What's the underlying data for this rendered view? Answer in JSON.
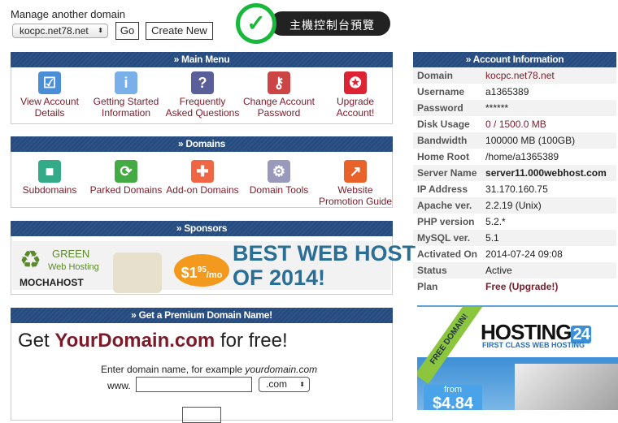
{
  "manage": {
    "label": "Manage another domain",
    "domain": "kocpc.net78.net",
    "go": "Go",
    "create": "Create New"
  },
  "badge": {
    "text": "主機控制台預覽",
    "color": "#18b83b"
  },
  "main_menu": {
    "title": "» Main Menu",
    "items": [
      {
        "l1": "View Account",
        "l2": "Details",
        "icon": "checklist-icon"
      },
      {
        "l1": "Getting Started",
        "l2": "Information",
        "icon": "info-icon"
      },
      {
        "l1": "Frequently",
        "l2": "Asked Questions",
        "icon": "question-icon"
      },
      {
        "l1": "Change Account",
        "l2": "Password",
        "icon": "keys-icon"
      },
      {
        "l1": "Upgrade",
        "l2": "Account!",
        "icon": "ribbon-icon"
      }
    ]
  },
  "domains": {
    "title": "» Domains",
    "items": [
      {
        "l1": "",
        "l2": "Subdomains",
        "icon": "cubes-icon"
      },
      {
        "l1": "",
        "l2": "Parked Domains",
        "icon": "arrows-icon"
      },
      {
        "l1": "",
        "l2": "Add-on Domains",
        "icon": "molecule-icon"
      },
      {
        "l1": "",
        "l2": "Domain Tools",
        "icon": "gears-icon"
      },
      {
        "l1": "Website",
        "l2": "Promotion Guide",
        "icon": "arrow-circle-icon"
      }
    ]
  },
  "sponsors": {
    "title": "» Sponsors",
    "ad": {
      "green": "GREEN",
      "web_hosting": "Web Hosting",
      "brand": "MOCHAHOST",
      "price": "$1",
      "cents": "95",
      "per": "/mo",
      "line1": "BEST WEB HOST",
      "line2": "OF 2014!"
    }
  },
  "premium": {
    "title": "» Get a Premium Domain Name!",
    "get": "Get ",
    "domain": "YourDomain.com",
    "free": " for free!",
    "hint": "Enter domain name, for example ",
    "hint_example": "yourdomain.com",
    "www": "www.",
    "tld": ".com",
    "input_value": ""
  },
  "account": {
    "title": "» Account Information",
    "rows": [
      {
        "k": "Domain",
        "v": "kocpc.net78.net"
      },
      {
        "k": "Username",
        "v": "a1365389"
      },
      {
        "k": "Password",
        "v": "******"
      },
      {
        "k": "Disk Usage",
        "v": "0 / 1500.0 MB"
      },
      {
        "k": "Bandwidth",
        "v": "100000 MB (100GB)"
      },
      {
        "k": "Home Root",
        "v": "/home/a1365389"
      },
      {
        "k": "Server Name",
        "v": "server11.000webhost.com"
      },
      {
        "k": "IP Address",
        "v": "31.170.160.75"
      },
      {
        "k": "Apache ver.",
        "v": "2.2.19 (Unix)"
      },
      {
        "k": "PHP version",
        "v": "5.2.*"
      },
      {
        "k": "MySQL ver.",
        "v": "5.1"
      },
      {
        "k": "Activated On",
        "v": "2014-07-24 09:08"
      },
      {
        "k": "Status",
        "v": "Active"
      },
      {
        "k": "Plan",
        "v": "Free (Upgrade!)"
      }
    ]
  },
  "hosting_ad": {
    "ribbon": "FREE DOMAIN!",
    "brand": "HOSTING",
    "num": "24",
    "tagline": "FIRST CLASS WEB HOSTING",
    "from": "from",
    "price": "$4.84"
  }
}
